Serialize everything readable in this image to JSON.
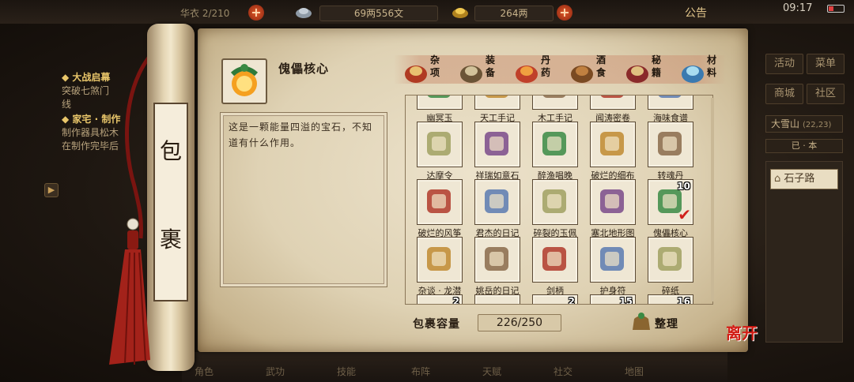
{
  "topbar": {
    "top_left_text": "华衣 2/210",
    "silver": "69两556文",
    "gold": "264两",
    "announce": "公告",
    "clock": "09:17"
  },
  "quest": {
    "items": [
      {
        "title": "◆ 大战启幕",
        "lines": [
          "突破七煞门",
          "线"
        ]
      },
      {
        "title": "◆ 家宅 · 制作",
        "lines": [
          "制作器具松木",
          "在制作完毕后"
        ]
      }
    ]
  },
  "side": {
    "buttons": [
      "活动",
      "菜单",
      "商城",
      "社区"
    ],
    "location": "大雪山",
    "location_coords": "(22,23)",
    "minimap": "已 · 本",
    "road": "石子路"
  },
  "bottom": {
    "labels": [
      "角色",
      "武功",
      "技能",
      "布阵",
      "天赋",
      "社交",
      "地图"
    ]
  },
  "scroll": {
    "title_top": "包",
    "title_bottom": "裹"
  },
  "selected": {
    "name": "傀儡核心",
    "description": "这是一颗能量四溢的宝石，不知道有什么作用。"
  },
  "tabs": [
    {
      "label": "杂项",
      "icon": "pot-icon",
      "active": true
    },
    {
      "label": "装备",
      "icon": "weapon-icon",
      "active": false
    },
    {
      "label": "丹药",
      "icon": "pill-icon",
      "active": false
    },
    {
      "label": "酒食",
      "icon": "wine-icon",
      "active": false
    },
    {
      "label": "秘籍",
      "icon": "book-icon",
      "active": false
    },
    {
      "label": "材料",
      "icon": "crystal-icon",
      "active": false
    }
  ],
  "grid": {
    "rows": [
      [
        {
          "name": "幽冥玉",
          "icon": "jade-icon",
          "count": ""
        },
        {
          "name": "天工手记",
          "icon": "note-icon",
          "count": ""
        },
        {
          "name": "木工手记",
          "icon": "note-icon",
          "count": ""
        },
        {
          "name": "闻涛密卷",
          "icon": "scroll-icon",
          "count": ""
        },
        {
          "name": "海味食谱",
          "icon": "recipe-icon",
          "count": ""
        }
      ],
      [
        {
          "name": "达摩令",
          "icon": "token-icon",
          "count": ""
        },
        {
          "name": "祥瑞如意石",
          "icon": "gem-icon",
          "count": ""
        },
        {
          "name": "醉渔唱晚",
          "icon": "book-icon",
          "count": ""
        },
        {
          "name": "破烂的细布",
          "icon": "cloth-icon",
          "count": ""
        },
        {
          "name": "转魂丹",
          "icon": "pill-box-icon",
          "count": ""
        }
      ],
      [
        {
          "name": "破烂的风筝",
          "icon": "kite-icon",
          "count": ""
        },
        {
          "name": "君杰的日记",
          "icon": "scroll-icon",
          "count": ""
        },
        {
          "name": "碎裂的玉佩",
          "icon": "pendant-icon",
          "count": ""
        },
        {
          "name": "塞北地形图",
          "icon": "map-icon",
          "count": ""
        },
        {
          "name": "傀儡核心",
          "icon": "core-icon",
          "count": "10"
        }
      ],
      [
        {
          "name": "杂谈 · 龙潜",
          "icon": "scroll-icon",
          "count": ""
        },
        {
          "name": "姚岳的日记",
          "icon": "scroll-icon",
          "count": ""
        },
        {
          "name": "剑柄",
          "icon": "hilt-icon",
          "count": ""
        },
        {
          "name": "护身符",
          "icon": "amulet-icon",
          "count": ""
        },
        {
          "name": "碎纸",
          "icon": "paper-icon",
          "count": ""
        }
      ],
      [
        {
          "name": "",
          "icon": "item-icon",
          "count": "2"
        },
        {
          "name": "",
          "icon": "item-icon",
          "count": ""
        },
        {
          "name": "",
          "icon": "item-icon",
          "count": "2"
        },
        {
          "name": "",
          "icon": "item-icon",
          "count": "15"
        },
        {
          "name": "",
          "icon": "item-icon",
          "count": "16"
        }
      ]
    ]
  },
  "capacity": {
    "label": "包裹容量",
    "value": "226/250"
  },
  "sort_label": "整理",
  "leave_label": "离开"
}
